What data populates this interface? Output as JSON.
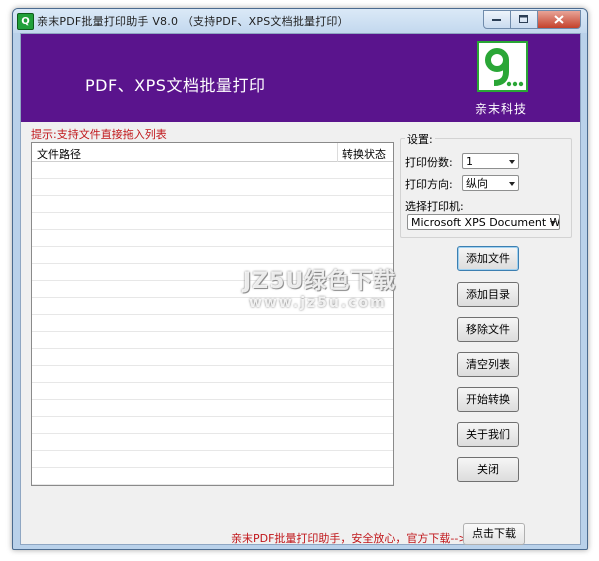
{
  "window": {
    "title": "亲末PDF批量打印助手 V8.0  （支持PDF、XPS文档批量打印）",
    "icon": "app-q-icon"
  },
  "banner": {
    "title": "PDF、XPS文档批量打印",
    "logo_text": "9...",
    "brand": "亲末科技",
    "bg_color": "#5a148d"
  },
  "hint": "提示:支持文件直接拖入列表",
  "table": {
    "columns": [
      "文件路径",
      "转换状态"
    ],
    "rows": []
  },
  "settings": {
    "group_label": "设置:",
    "copies_label": "打印份数:",
    "copies_value": "1",
    "orientation_label": "打印方向:",
    "orientation_value": "纵向",
    "printer_label": "选择打印机:",
    "printer_value": "Microsoft XPS Document Writer"
  },
  "buttons": {
    "add_file": "添加文件",
    "add_folder": "添加目录",
    "remove_file": "移除文件",
    "clear_list": "清空列表",
    "start_convert": "开始转换",
    "about": "关于我们",
    "close": "关闭"
  },
  "footer": {
    "text": "亲末PDF批量打印助手，安全放心，官方下载-->>",
    "link": "点击下载"
  },
  "watermark": {
    "line1": "JZ5U绿色下载",
    "line2": "www.jz5u.com"
  },
  "colors": {
    "accent_red": "#c0161a",
    "logo_green": "#2aa636"
  }
}
